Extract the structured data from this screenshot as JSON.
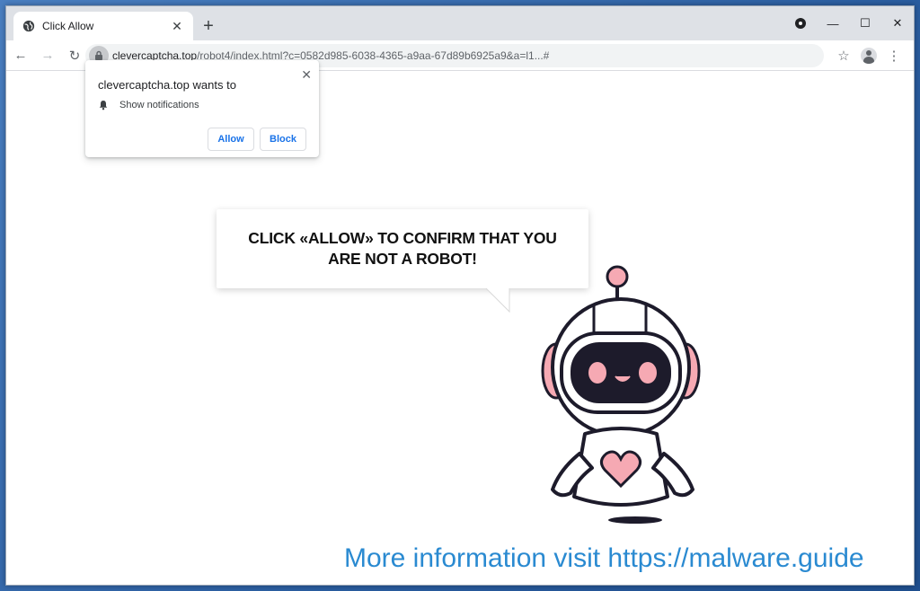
{
  "tab": {
    "title": "Click Allow",
    "close_glyph": "✕",
    "new_tab_glyph": "+"
  },
  "window_controls": {
    "minimize": "—",
    "maximize": "☐",
    "close": "✕"
  },
  "toolbar": {
    "back": "←",
    "forward": "→",
    "reload": "↻",
    "url_host": "clevercaptcha.top",
    "url_path": "/robot4/index.html?c=0582d985-6038-4365-a9aa-67d89b6925a9&a=l1...#",
    "star": "☆",
    "menu": "⋮"
  },
  "permission_popup": {
    "title": "clevercaptcha.top wants to",
    "permission": "Show notifications",
    "allow_label": "Allow",
    "block_label": "Block",
    "close_glyph": "✕"
  },
  "page": {
    "bubble_line1": "CLICK «ALLOW» TO CONFIRM THAT YOU",
    "bubble_line2": "ARE NOT A ROBOT!"
  },
  "watermark": "More information visit https://malware.guide",
  "colors": {
    "robot_pink": "#f6a9b3",
    "robot_dark": "#1d1b2b",
    "watermark": "#2a8ad1",
    "link_blue": "#1a73e8"
  }
}
